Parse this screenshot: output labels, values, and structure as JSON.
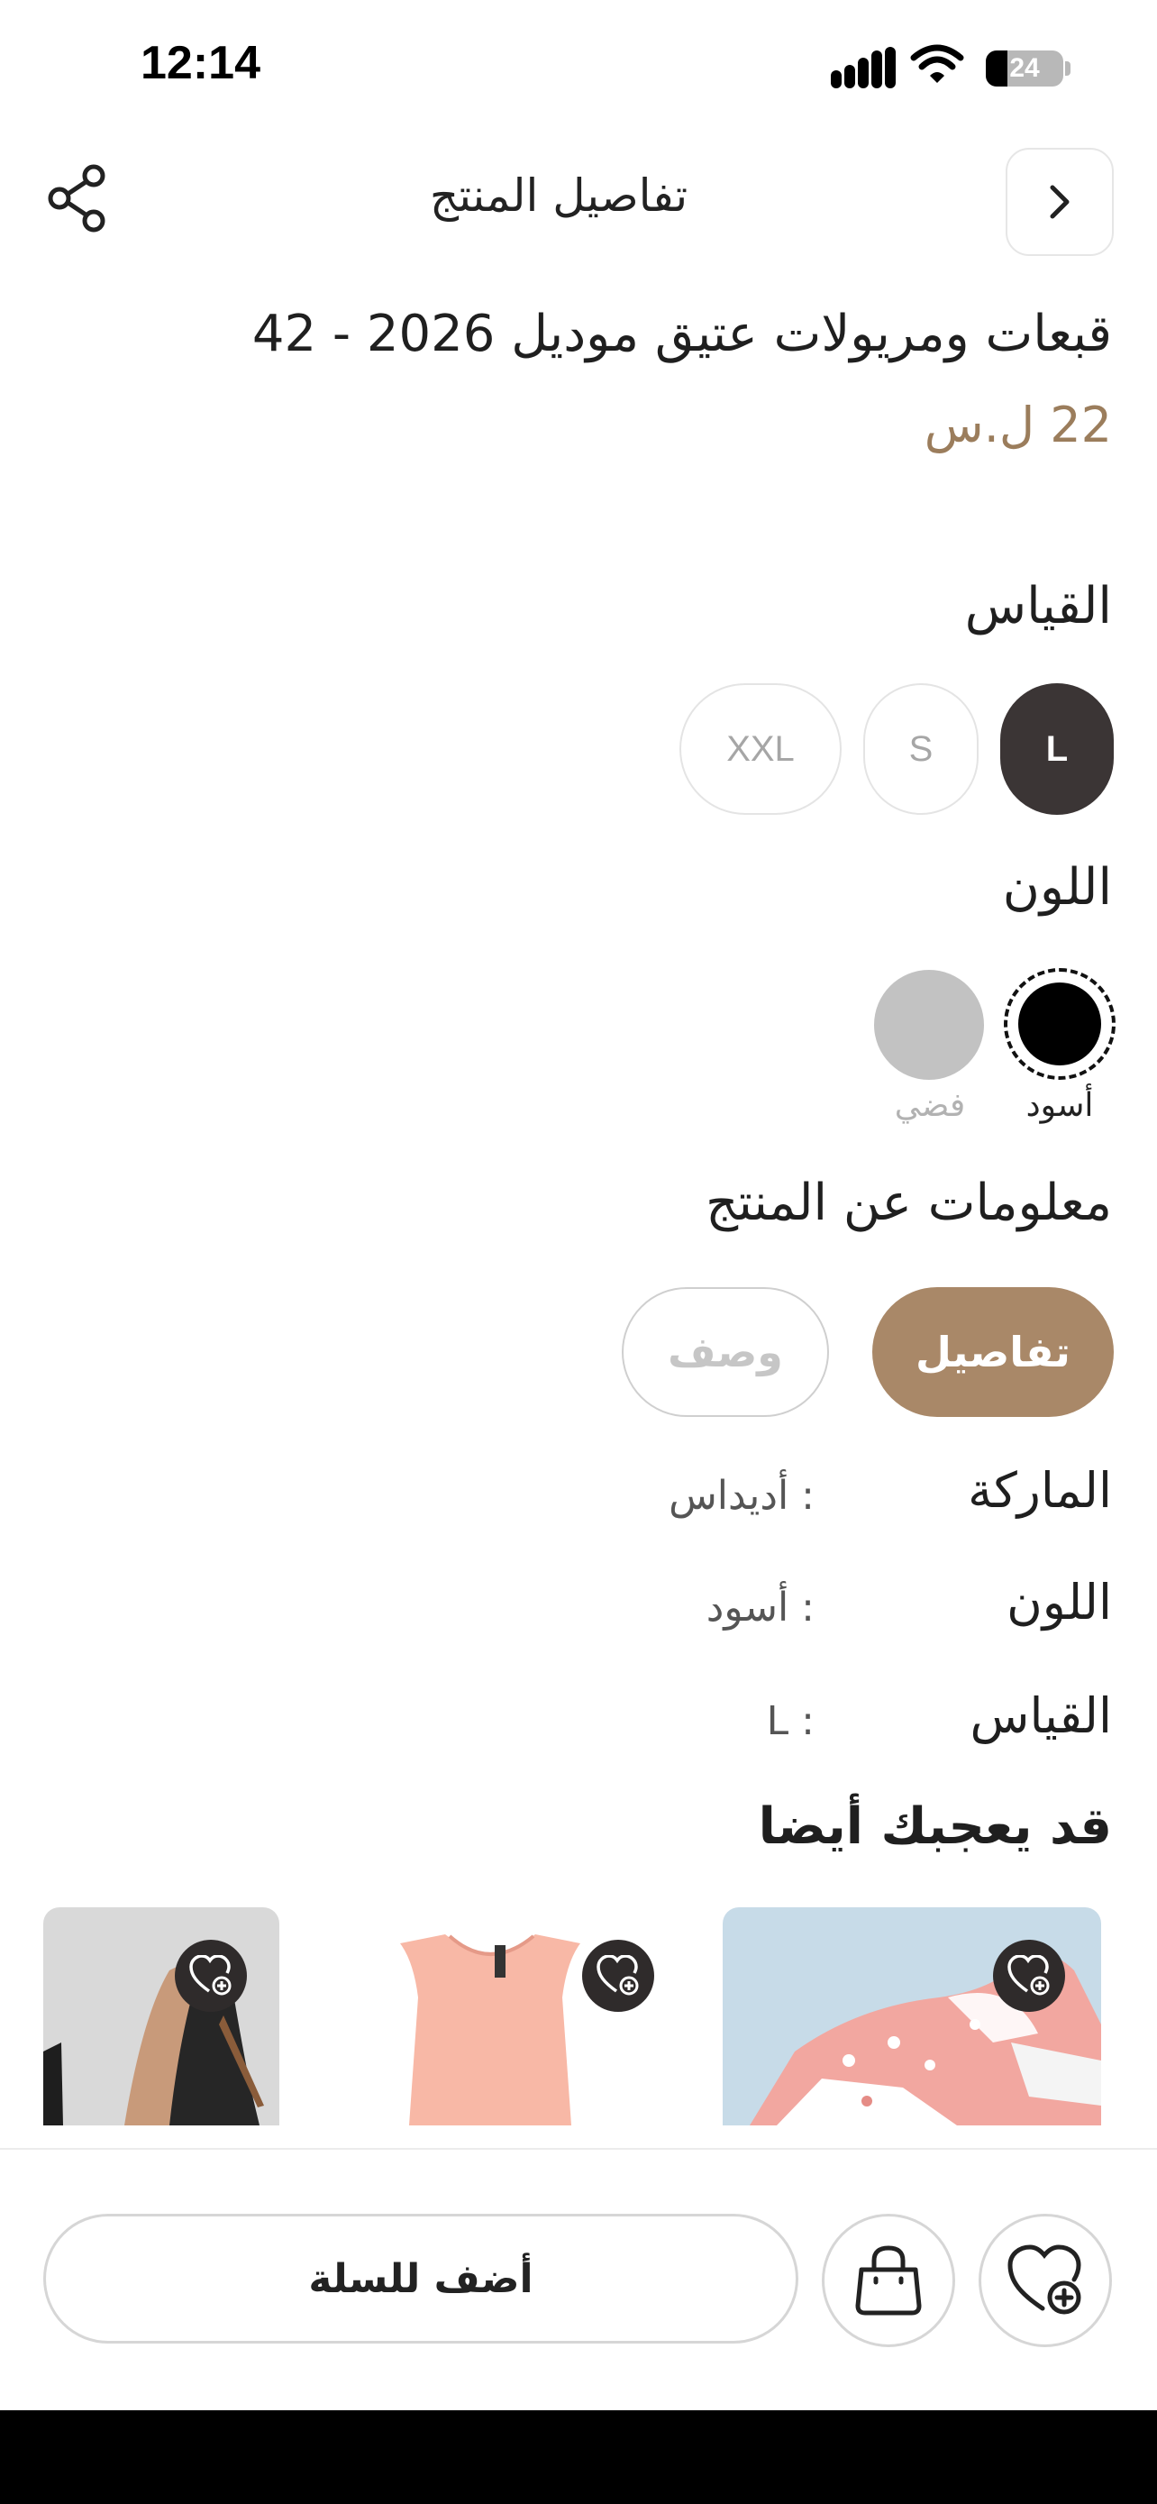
{
  "status_bar": {
    "time": "12:14",
    "battery": "24"
  },
  "header": {
    "title": "تفاصيل المنتج"
  },
  "product": {
    "title": "قبعات ومريولات عتيق موديل 2026 - 42",
    "price": "22 ل.س"
  },
  "size_section": {
    "label": "القياس",
    "options": [
      "L",
      "S",
      "XXL"
    ],
    "selected": "L"
  },
  "color_section": {
    "label": "اللون",
    "options": [
      {
        "name": "أسود",
        "hex": "#000000",
        "selected": true
      },
      {
        "name": "فضي",
        "hex": "#c2c2c2",
        "selected": false
      }
    ]
  },
  "info_section": {
    "title": "معلومات عن المنتج",
    "tabs": [
      "تفاصيل",
      "وصف"
    ],
    "active_tab": "تفاصيل",
    "rows": [
      {
        "key": "الماركة",
        "value": ": أديداس"
      },
      {
        "key": "اللون",
        "value": ": أسود"
      },
      {
        "key": "القياس",
        "value": ": L"
      }
    ]
  },
  "recommendations": {
    "title": "قد يعجبك أيضا",
    "items": [
      {
        "image": "pink-sneakers"
      },
      {
        "image": "peach-sleeveless-top"
      },
      {
        "image": "black-heels"
      }
    ]
  },
  "bottom_bar": {
    "add_to_cart": "أضف للسلة"
  },
  "colors": {
    "accent": "#a98868",
    "price": "#9b7d5c",
    "dark": "#3b3535"
  },
  "icons": [
    "back-chevron-icon",
    "share-icon",
    "heart-plus-icon",
    "shopping-bag-icon"
  ]
}
